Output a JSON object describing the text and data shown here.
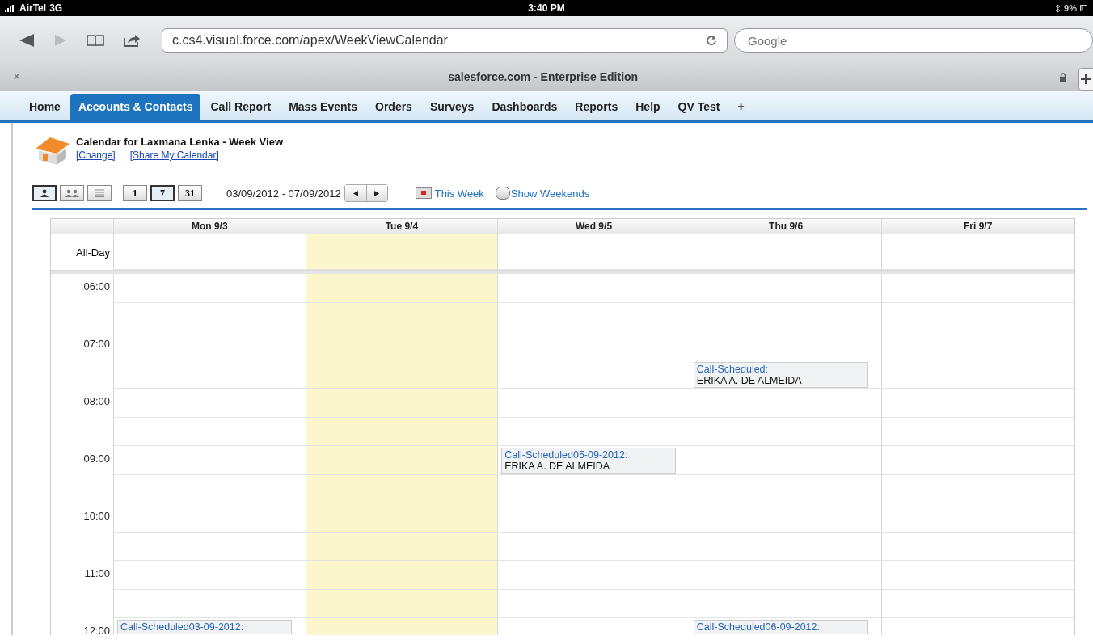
{
  "status_bar": {
    "carrier": "AirTel",
    "network": "3G",
    "time": "3:40 PM",
    "battery": "9%"
  },
  "browser": {
    "url": "c.cs4.visual.force.com/apex/WeekViewCalendar",
    "search": {
      "placeholder": "Google"
    },
    "tab_title": "salesforce.com - Enterprise Edition",
    "close": "×"
  },
  "nav_tabs": [
    {
      "label": "Home",
      "selected": false
    },
    {
      "label": "Accounts & Contacts",
      "selected": true
    },
    {
      "label": "Call Report",
      "selected": false
    },
    {
      "label": "Mass Events",
      "selected": false
    },
    {
      "label": "Orders",
      "selected": false
    },
    {
      "label": "Surveys",
      "selected": false
    },
    {
      "label": "Dashboards",
      "selected": false
    },
    {
      "label": "Reports",
      "selected": false
    },
    {
      "label": "Help",
      "selected": false
    },
    {
      "label": "QV Test",
      "selected": false
    },
    {
      "label": "+",
      "selected": false
    }
  ],
  "page_header": {
    "title": "Calendar for  Laxmana Lenka - Week View",
    "links": [
      "[Change]",
      "[Share My Calendar]"
    ]
  },
  "view_buttons": [
    {
      "kind": "single-user",
      "selected": true
    },
    {
      "kind": "multi-user",
      "selected": false
    },
    {
      "kind": "list",
      "selected": false
    },
    {
      "kind": "day",
      "label": "1",
      "selected": false
    },
    {
      "kind": "week",
      "label": "7",
      "selected": true
    },
    {
      "kind": "month",
      "label": "31",
      "selected": false
    }
  ],
  "date_range": "03/09/2012 - 07/09/2012",
  "this_week": "This Week",
  "show_weekends": {
    "label": "Show Weekends",
    "checked": false
  },
  "calendar": {
    "days": [
      "Mon 9/3",
      "Tue 9/4",
      "Wed 9/5",
      "Thu 9/6",
      "Fri 9/7"
    ],
    "all_day": {
      "label": "All-Day",
      "cells": [
        {
          "today": false
        },
        {
          "today": true
        },
        {
          "today": false
        },
        {
          "today": false
        },
        {
          "today": false
        }
      ]
    },
    "rows": [
      {
        "label": "06:00",
        "cells": [
          {
            "today": false
          },
          {
            "today": true
          },
          {
            "today": false
          },
          {
            "today": false
          },
          {
            "today": false
          }
        ]
      },
      {
        "cells": [
          {
            "today": false
          },
          {
            "today": true
          },
          {
            "today": false
          },
          {
            "today": false
          },
          {
            "today": false
          }
        ]
      },
      {
        "label": "07:00",
        "cells": [
          {
            "today": false
          },
          {
            "today": true
          },
          {
            "today": false
          },
          {
            "today": false
          },
          {
            "today": false
          }
        ]
      },
      {
        "cells": [
          {
            "today": false
          },
          {
            "today": true
          },
          {
            "today": false
          },
          {
            "today": false,
            "event": {
              "title": "Call-Scheduled:",
              "contact": "ERIKA A. DE ALMEIDA"
            }
          },
          {
            "today": false
          }
        ]
      },
      {
        "label": "08:00",
        "cells": [
          {
            "today": false
          },
          {
            "today": true
          },
          {
            "today": false
          },
          {
            "today": false
          },
          {
            "today": false
          }
        ]
      },
      {
        "cells": [
          {
            "today": false
          },
          {
            "today": true
          },
          {
            "today": false
          },
          {
            "today": false
          },
          {
            "today": false
          }
        ]
      },
      {
        "label": "09:00",
        "cells": [
          {
            "today": false
          },
          {
            "today": true
          },
          {
            "today": false,
            "event": {
              "title": "Call-Scheduled05-09-2012:",
              "contact": "ERIKA A. DE ALMEIDA"
            }
          },
          {
            "today": false
          },
          {
            "today": false
          }
        ]
      },
      {
        "cells": [
          {
            "today": false
          },
          {
            "today": true
          },
          {
            "today": false
          },
          {
            "today": false
          },
          {
            "today": false
          }
        ]
      },
      {
        "label": "10:00",
        "cells": [
          {
            "today": false
          },
          {
            "today": true
          },
          {
            "today": false
          },
          {
            "today": false
          },
          {
            "today": false
          }
        ]
      },
      {
        "cells": [
          {
            "today": false
          },
          {
            "today": true
          },
          {
            "today": false
          },
          {
            "today": false
          },
          {
            "today": false
          }
        ]
      },
      {
        "label": "11:00",
        "cells": [
          {
            "today": false
          },
          {
            "today": true
          },
          {
            "today": false
          },
          {
            "today": false
          },
          {
            "today": false
          }
        ]
      },
      {
        "cells": [
          {
            "today": false
          },
          {
            "today": true
          },
          {
            "today": false
          },
          {
            "today": false
          },
          {
            "today": false
          }
        ]
      },
      {
        "label": "12:00",
        "cells": [
          {
            "today": false,
            "event": {
              "title": "Call-Scheduled03-09-2012:"
            }
          },
          {
            "today": true
          },
          {
            "today": false
          },
          {
            "today": false,
            "event": {
              "title": "Call-Scheduled06-09-2012:"
            }
          },
          {
            "today": false
          }
        ]
      }
    ]
  }
}
